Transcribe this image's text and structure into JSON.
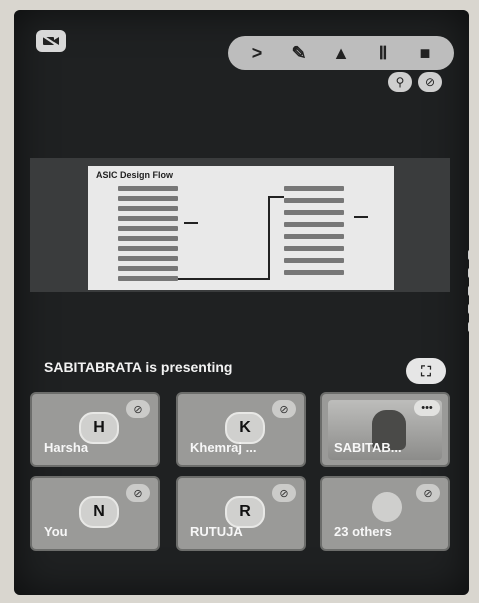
{
  "icons": {
    "camera_off": "camera-off-icon",
    "toolbar": [
      "chevron-right-icon",
      "pen-icon",
      "person-icon",
      "pause-icon",
      "stop-icon"
    ],
    "mini": [
      "pin-icon",
      "audio-off-icon"
    ]
  },
  "toolbar_glyphs": [
    ">",
    "✎",
    "▲",
    "Ⅱ",
    "■"
  ],
  "mini_glyphs": [
    "⚲",
    "⊘"
  ],
  "slide": {
    "title": "ASIC Design Flow"
  },
  "presentation": {
    "status": "SABITABRATA is presenting",
    "fullscreen_glyph": "⛶"
  },
  "participants": [
    {
      "initial": "H",
      "name": "Harsha",
      "muted": true
    },
    {
      "initial": "K",
      "name": "Khemraj ...",
      "muted": true
    },
    {
      "initial": "",
      "name": "SABITAB...",
      "video": true
    },
    {
      "initial": "N",
      "name": "You",
      "muted": true
    },
    {
      "initial": "R",
      "name": "RUTUJA",
      "muted": true
    },
    {
      "initial": "",
      "name": "23 others",
      "group": true,
      "muted": true
    }
  ],
  "mute_glyph": "⊘",
  "more_glyph": "•••"
}
